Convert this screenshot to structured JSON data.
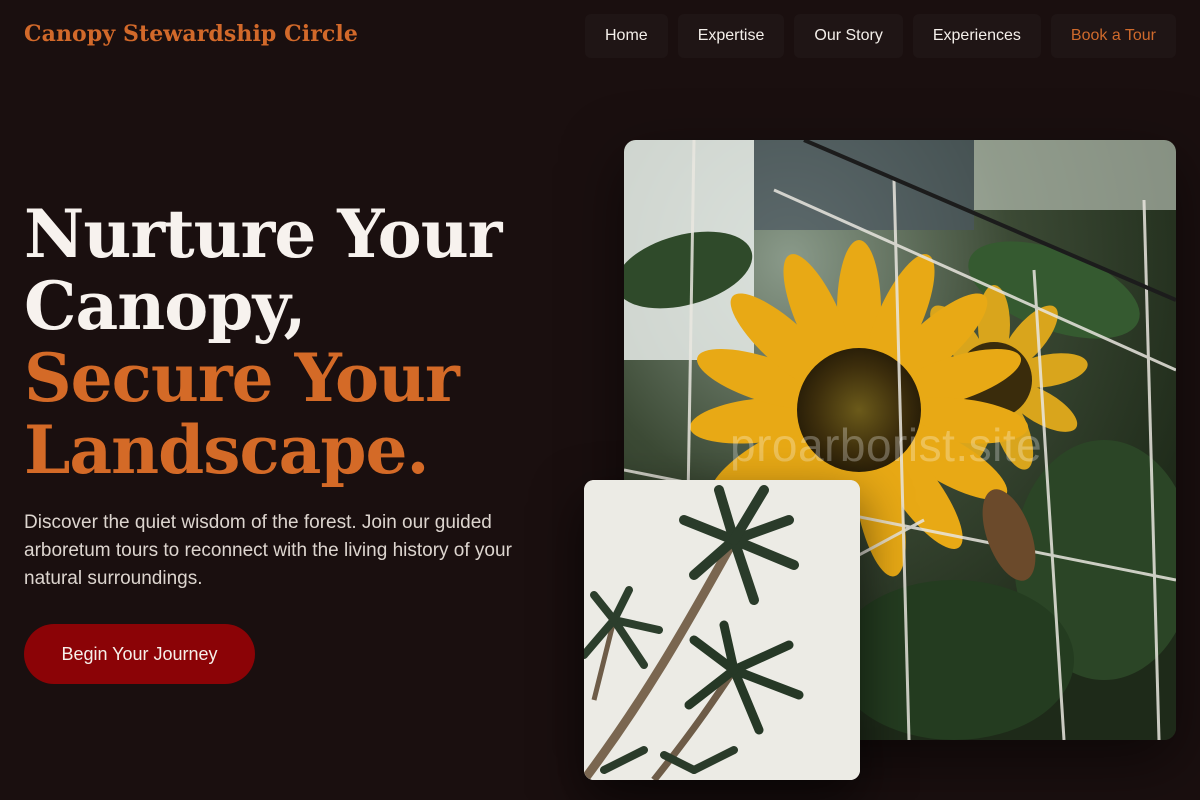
{
  "header": {
    "brand": "Canopy Stewardship Circle",
    "nav": [
      {
        "label": "Home"
      },
      {
        "label": "Expertise"
      },
      {
        "label": "Our Story"
      },
      {
        "label": "Experiences"
      },
      {
        "label": "Book a Tour"
      }
    ]
  },
  "hero": {
    "title_line1": "Nurture Your",
    "title_line2": "Canopy,",
    "title_line3": "Secure Your",
    "title_line4": "Landscape.",
    "description": "Discover the quiet wisdom of the forest. Join our guided arboretum tours to reconnect with the living history of your natural surroundings.",
    "cta_label": "Begin Your Journey"
  },
  "media": {
    "watermark": "proarborist.site",
    "large_image_icon": "sunflower-photo",
    "small_image_icon": "palm-trees-photo"
  },
  "colors": {
    "background": "#1a0f0f",
    "accent": "#d46a27",
    "cta": "#8b0306",
    "text": "#f7f2ee"
  }
}
